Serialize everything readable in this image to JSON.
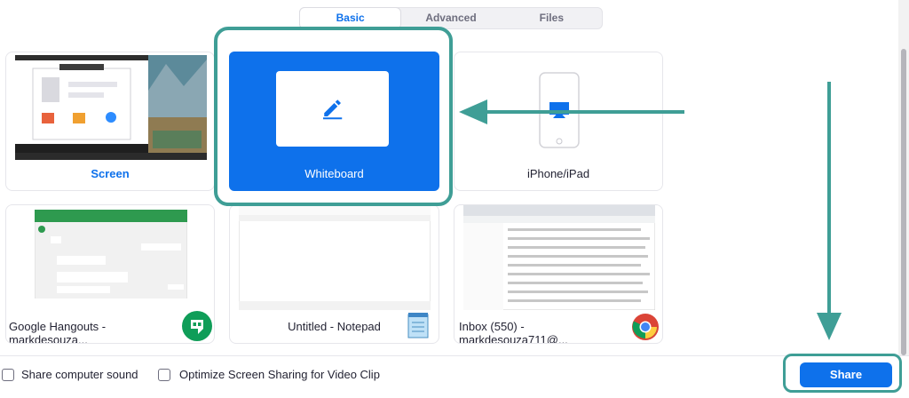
{
  "tabs": [
    {
      "label": "Basic",
      "active": true
    },
    {
      "label": "Advanced",
      "active": false
    },
    {
      "label": "Files",
      "active": false
    }
  ],
  "tiles": {
    "screen": {
      "label": "Screen",
      "selected": false
    },
    "whiteboard": {
      "label": "Whiteboard",
      "selected": true,
      "icon": "pencil-icon"
    },
    "iphone": {
      "label": "iPhone/iPad",
      "selected": false,
      "icon": "iphone-airplay-icon"
    },
    "hangouts": {
      "label": "Google Hangouts - markdesouza...",
      "icon": "hangouts-icon"
    },
    "notepad": {
      "label": "Untitled - Notepad",
      "icon": "notepad-icon"
    },
    "inbox": {
      "label": "Inbox (550) - markdesouza711@...",
      "icon": "chrome-icon"
    }
  },
  "options": {
    "share_sound": {
      "label": "Share computer sound",
      "checked": false
    },
    "optimize_video": {
      "label": "Optimize Screen Sharing for Video Clip",
      "checked": false
    }
  },
  "share_button": {
    "label": "Share"
  },
  "colors": {
    "accent": "#0e71eb",
    "annotation": "#3f9e96",
    "text": "#232333"
  }
}
